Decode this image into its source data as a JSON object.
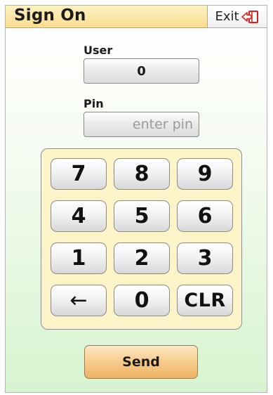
{
  "header": {
    "title": "Sign On",
    "exit_label": "Exit"
  },
  "user": {
    "label": "User",
    "value": "0"
  },
  "pin": {
    "label": "Pin",
    "placeholder": "enter pin",
    "value": ""
  },
  "keypad": {
    "keys": [
      "7",
      "8",
      "9",
      "4",
      "5",
      "6",
      "1",
      "2",
      "3",
      "←",
      "0",
      "CLR"
    ]
  },
  "send_label": "Send",
  "colors": {
    "title_bar": "#f9dd8e",
    "keypad_bg": "#fdf5c9",
    "send_button": "#f7c987",
    "background_gradient_end": "#d6f3cf"
  },
  "icons": {
    "exit": "exit-door-arrow-icon"
  }
}
